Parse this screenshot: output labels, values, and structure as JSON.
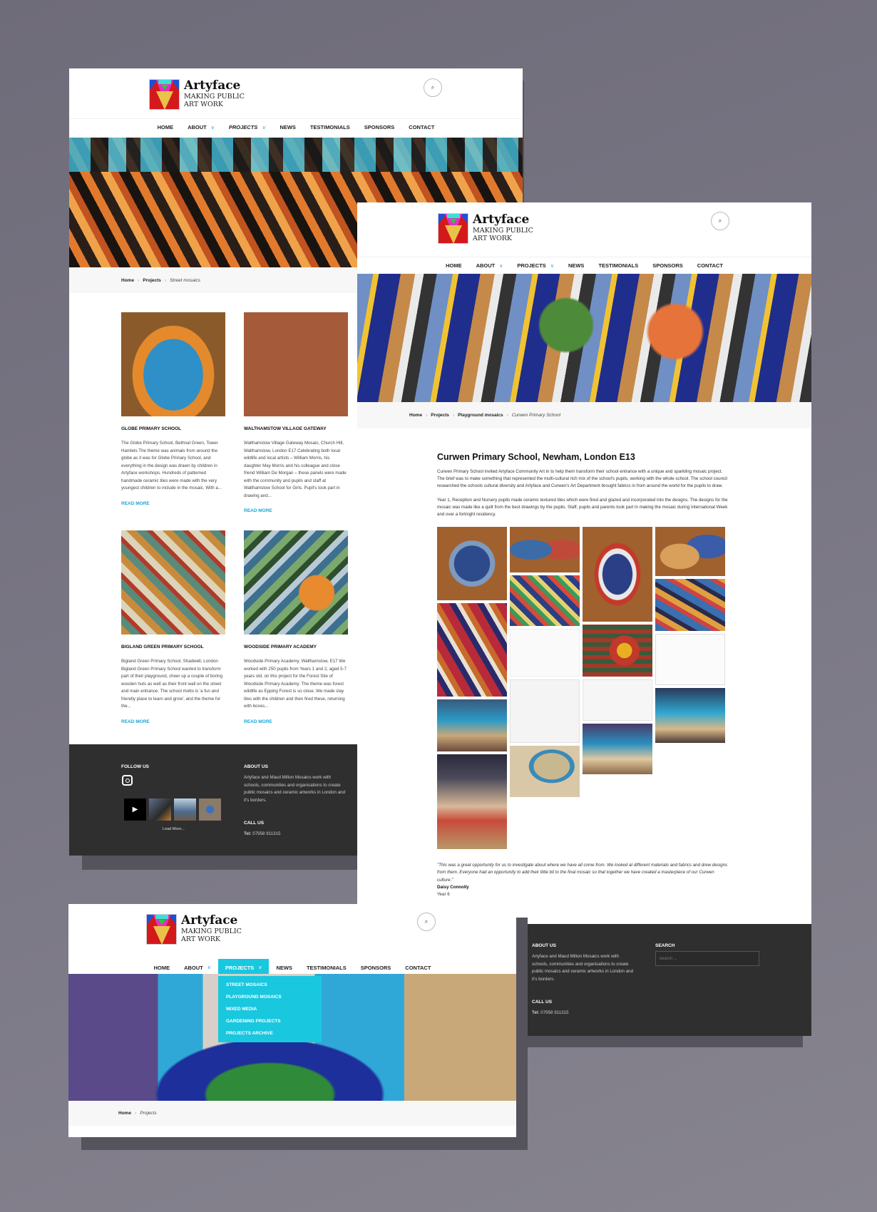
{
  "brand": {
    "name": "Artyface",
    "tagline_line1": "MAKING PUBLIC",
    "tagline_line2": "ART WORK",
    "accent_color": "#19c7df",
    "link_color": "#1aa6d6"
  },
  "nav": {
    "items": [
      {
        "label": "HOME"
      },
      {
        "label": "ABOUT",
        "chevron": "chevron-down-icon"
      },
      {
        "label": "PROJECTS",
        "chevron": "chevron-down-icon"
      },
      {
        "label": "NEWS"
      },
      {
        "label": "TESTIMONIALS"
      },
      {
        "label": "SPONSORS"
      },
      {
        "label": "CONTACT"
      }
    ],
    "chevron_glyph": "∨",
    "search_glyph": "⌕"
  },
  "screen1": {
    "breadcrumb": {
      "home": "Home",
      "projects": "Projects",
      "current": "Street mosaics",
      "sep": "›"
    },
    "cards": [
      {
        "title": "GLOBE PRIMARY SCHOOL",
        "excerpt": "The Globe Primary School, Bethnal Green, Tower Hamlets The theme was animals from around the globe as it was for Globe Primary School, and everything in the design was drawn by children in Artyface workshops. Hundreds of patterned handmade ceramic tiles were made with the very youngest children to include in the mosaic. With a...",
        "more": "READ MORE"
      },
      {
        "title": "WALTHAMSTOW VILLAGE GATEWAY",
        "excerpt": "Walthamstow Village Gateway Mosaic, Church Hill, Walthamstow, London E17 Celebrating both local wildlife and local artists – William Morris, his daughter May Morris and his colleague and close friend William De Morgan – these panels were made with the community and pupils and staff at Walthamstow School for Girls. Pupil's took part in drawing and...",
        "more": "READ MORE"
      },
      {
        "title": "BIGLAND GREEN PRIMARY SCHOOL",
        "excerpt": "Bigland Green Primary School, Shadwell, London Bigland Green Primary School wanted to transform part of their playground, cheer up a couple of boring wooden huts as well as their front wall on the street and main entrance. The school motto is 'a fun and friendly place to learn and grow', and the theme for the...",
        "more": "READ MORE"
      },
      {
        "title": "WOODSIDE PRIMARY ACADEMY",
        "excerpt": "Woodside Primary Academy, Walthamstow, E17 We worked with 250 pupils from Years 1 and 2, aged 5-7 years old, on this project for the Forest Site of Woodside Primary Academy. The theme was forest wildlife as Epping Forest is so close. We made clay tiles with the children and then fired these, returning with boxes...",
        "more": "READ MORE"
      }
    ],
    "footer": {
      "follow_title": "FOLLOW US",
      "load_more": "Load More...",
      "about_title": "ABOUT US",
      "about_text": "Artyface and Maud Milton Mosaics work with schools, communities and organisations to create public mosaics and ceramic artworks in London and it's borders.",
      "call_title": "CALL US",
      "tel_label": "Tel:",
      "tel_number": "07958 911315"
    }
  },
  "screen2": {
    "breadcrumb": {
      "home": "Home",
      "projects": "Projects",
      "category": "Playground mosaics",
      "current": "Curwen Primary School",
      "sep": "›"
    },
    "title": "Curwen Primary School, Newham, London E13",
    "para1": "Curwen Primary School invited Artyface Community Art in to help them transform their school entrance with a unique and sparkling mosaic project. The brief was to make something that represented the multi-cultural rich mix of the school's pupils, working with the whole school. The school council researched the schools cultural diversity and Artyface and Curwen's Art Department brought fabrics in from around the world for the pupils to draw.",
    "para2": "Year 1, Reception and Nursery pupils made ceramic textured tiles which were fired and glazed and incorporated into the designs. The designs for the mosaic was made like a quilt from the best drawings by the pupils. Staff, pupils and parents took part in making the mosaic during International Week and over a fortnight residency.",
    "quote": "\"This was a great opportunity for us to investigate about where we have all come from. We looked at different materials and fabrics and drew designs from them. Everyone had an opportunity to add their little bit to the final mosaic so that together we have created a masterpiece of our Curwen culture.\"",
    "quote_author": "Daisy Connolly",
    "quote_role": "Year 6",
    "footer": {
      "about_title": "ABOUT US",
      "about_text": "Artyface and Maud Milton Mosaics work with schools, communities and organisations to create public mosaics and ceramic artworks in London and it's borders.",
      "call_title": "CALL US",
      "tel_label": "Tel:",
      "tel_number": "07958 911315",
      "search_title": "SEARCH",
      "search_placeholder": "Search ..."
    }
  },
  "screen3": {
    "dropdown": [
      "STREET MOSAICS",
      "PLAYGROUND MOSAICS",
      "MIXED MEDIA",
      "GARDENING PROJECTS",
      "PROJECTS ARCHIVE"
    ],
    "breadcrumb": {
      "home": "Home",
      "current": "Projects",
      "sep": "›"
    }
  }
}
